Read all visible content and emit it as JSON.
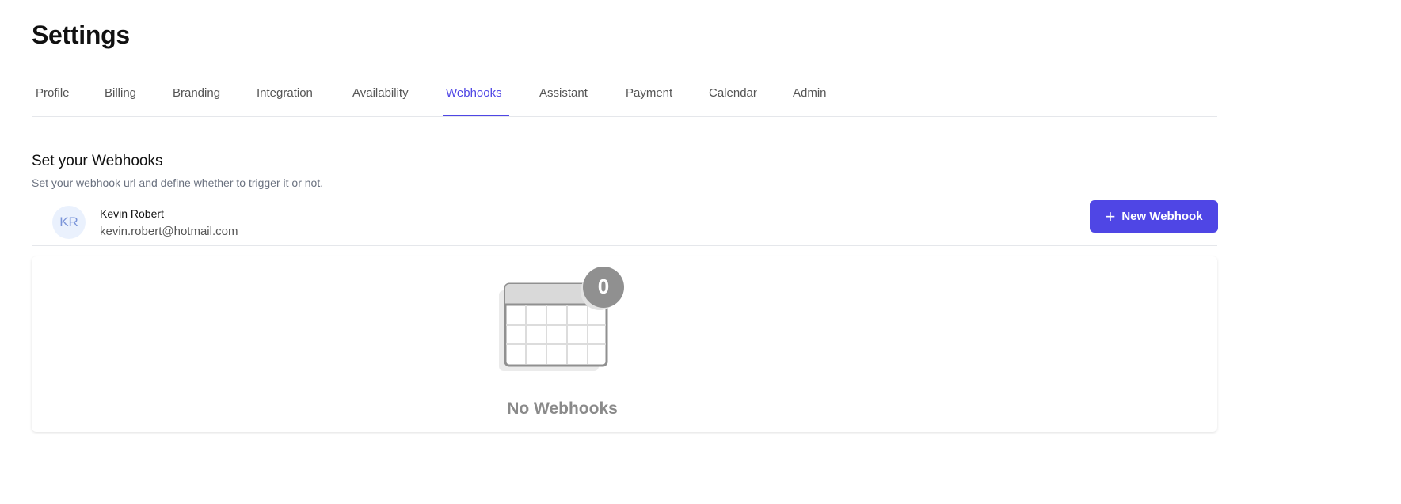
{
  "title": "Settings",
  "tabs": [
    "Profile",
    "Billing",
    "Branding",
    "Integration",
    "Availability",
    "Webhooks",
    "Assistant",
    "Payment",
    "Calendar",
    "Admin"
  ],
  "active_tab": "Webhooks",
  "section": {
    "title": "Set your Webhooks",
    "subtitle": "Set your webhook url and define whether to trigger it or not."
  },
  "user": {
    "initials": "KR",
    "name": "Kevin Robert",
    "email": "kevin.robert@hotmail.com"
  },
  "new_webhook_button": {
    "icon": "plus-icon",
    "label": "New Webhook"
  },
  "empty_state": {
    "count": "0",
    "message": "No Webhooks",
    "icon": "calendar-icon"
  },
  "colors": {
    "accent": "#4f46e5"
  }
}
